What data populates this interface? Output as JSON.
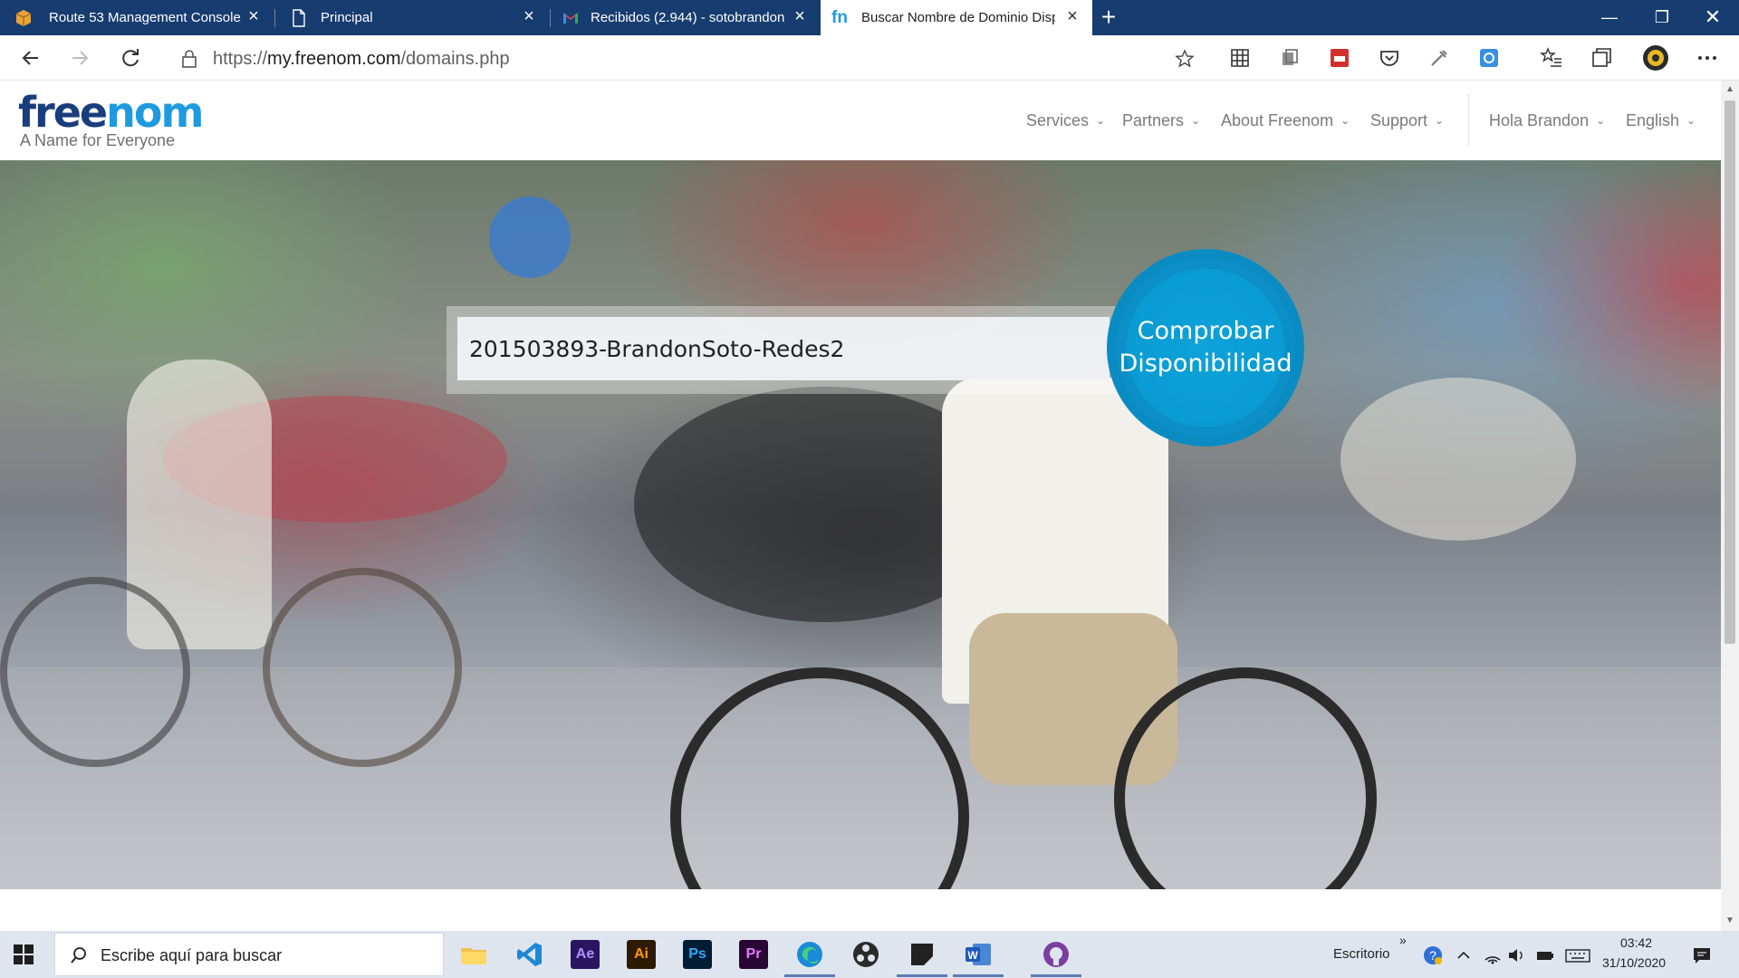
{
  "browser": {
    "tabs": [
      {
        "title": "Route 53 Management Console",
        "icon": "aws-box-icon",
        "active": false
      },
      {
        "title": "Principal",
        "icon": "page-icon",
        "active": false
      },
      {
        "title": "Recibidos (2.944) - sotobrandon",
        "icon": "gmail-icon",
        "active": false
      },
      {
        "title": "Buscar Nombre de Dominio Disp",
        "icon": "freenom-icon",
        "active": true
      }
    ],
    "url_prefix": "https://",
    "url_host": "my.freenom.com",
    "url_path": "/domains.php"
  },
  "site": {
    "logo_free": "free",
    "logo_nom": "nom",
    "tagline": "A Name for Everyone",
    "menu": [
      "Services",
      "Partners",
      "About Freenom",
      "Support"
    ],
    "user_menu": "Hola Brandon",
    "language_menu": "English"
  },
  "hero": {
    "search_value": "201503893-BrandonSoto-Redes2",
    "check_line1": "Comprobar",
    "check_line2": "Disponibilidad"
  },
  "taskbar": {
    "search_placeholder": "Escribe aquí para buscar",
    "apps": [
      "file-explorer",
      "vscode",
      "after-effects",
      "illustrator",
      "photoshop",
      "premiere",
      "edge",
      "obs",
      "sticky-app",
      "word",
      "github-desktop"
    ],
    "ae_label": "Ae",
    "ai_label": "Ai",
    "ps_label": "Ps",
    "pr_label": "Pr",
    "desktop_label": "Escritorio",
    "time": "03:42",
    "date": "31/10/2020"
  },
  "colors": {
    "tab_strip": "#173c70",
    "freenom_dark": "#1a3d7d",
    "freenom_light": "#1f9ae0",
    "check_button": "#0a9bd3"
  }
}
